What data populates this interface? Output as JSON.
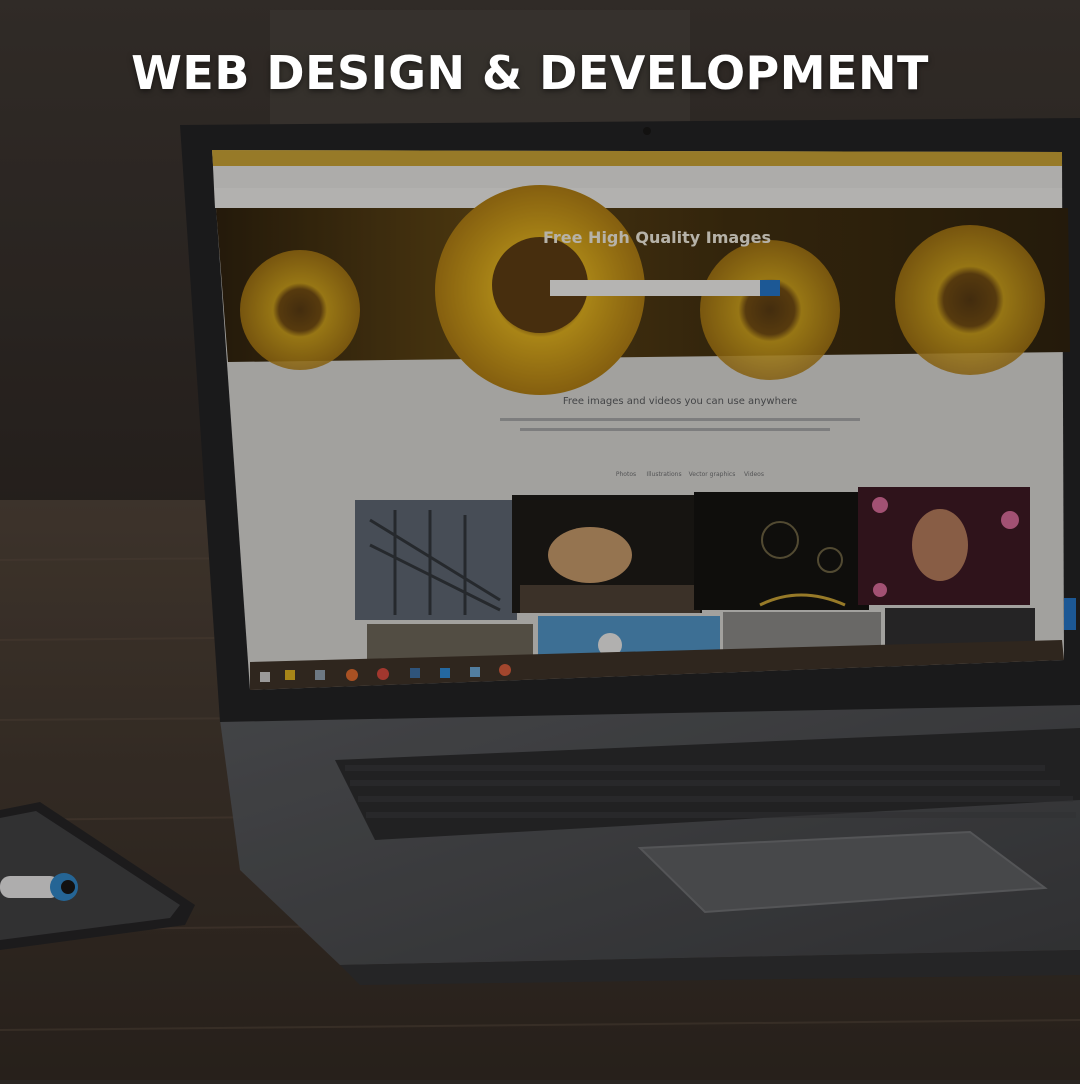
{
  "headline": "WEB DESIGN & DEVELOPMENT",
  "screen": {
    "hero_title": "Free High Quality Images",
    "section_title": "Free images and videos you can use anywhere",
    "tabs": [
      "Photos",
      "Illustrations",
      "Vector graphics",
      "Videos"
    ]
  },
  "colors": {
    "background": "#2a2622",
    "headline": "#ffffff",
    "laptop_body": "#4a4c50",
    "browser_tabs": "#c9a233",
    "sunflower": "#e0b21c",
    "accent_blue": "#1f73c9"
  }
}
